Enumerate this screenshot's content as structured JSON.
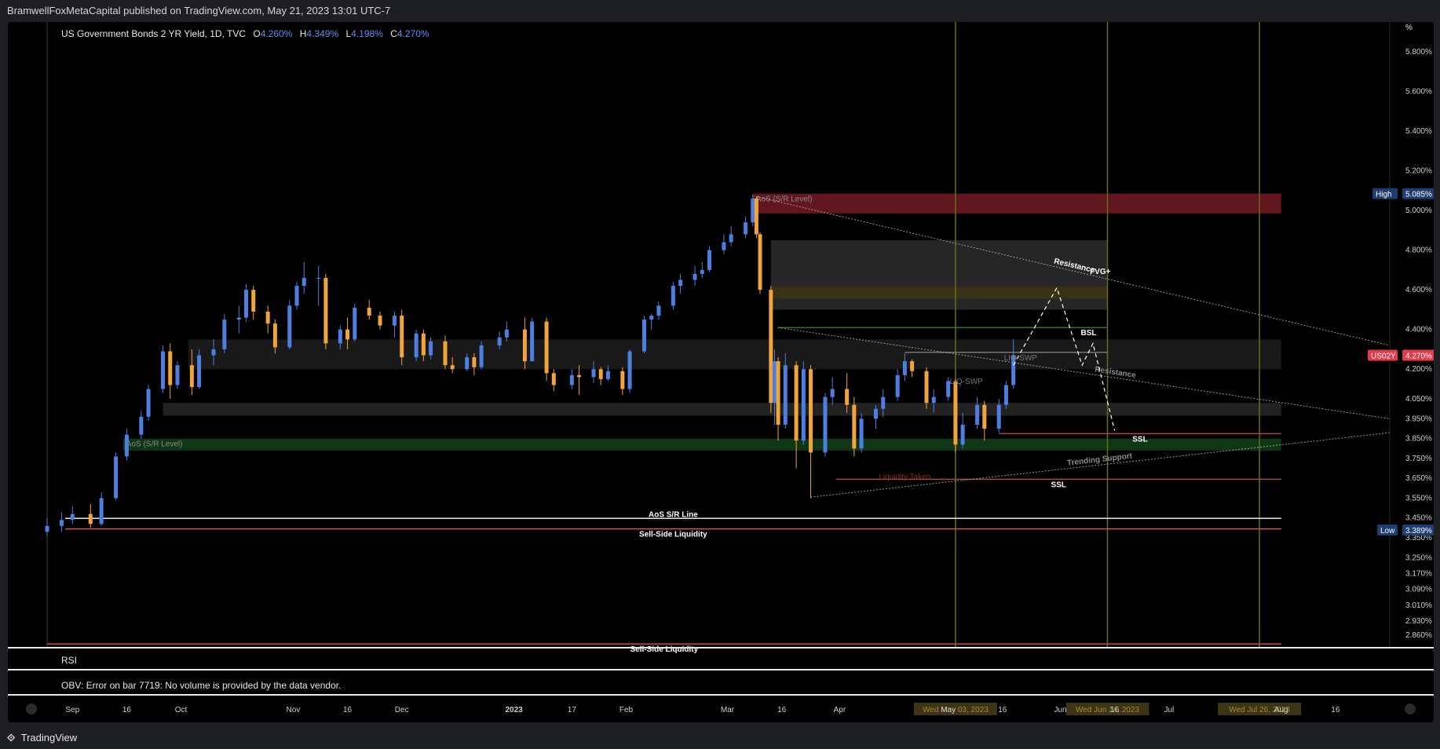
{
  "header": {
    "published": "BramwellFoxMetaCapital published on TradingView.com, May 21, 2023 13:01 UTC-7"
  },
  "legend": {
    "title": "US Government Bonds 2 YR Yield, 1D, TVC",
    "o_label": "O",
    "o_value": "4.260%",
    "h_label": "H",
    "h_value": "4.349%",
    "l_label": "L",
    "l_value": "4.198%",
    "c_label": "C",
    "c_value": "4.270%"
  },
  "panes": {
    "rsi_label": "RSI",
    "obv_label": "OBV: Error on bar 7719: No volume is provided by the data vendor."
  },
  "footer": {
    "brand": "TradingView"
  },
  "colors": {
    "up": "#4d7fe0",
    "down": "#f0a43a",
    "background": "#000000",
    "supply_zone": "#6b1a20",
    "fvg": "#3d3415",
    "demand_zone": "#123d17",
    "gray_zone": "#2a2a2a"
  },
  "chart_data": {
    "type": "candlestick",
    "title": "US Government Bonds 2 YR Yield, 1D, TVC",
    "symbol": "US02Y",
    "y_unit": "%",
    "ylim": [
      2.8,
      5.95
    ],
    "y_ticks": [
      "5.800%",
      "5.600%",
      "5.400%",
      "5.200%",
      "5.000%",
      "4.800%",
      "4.600%",
      "4.400%",
      "4.200%",
      "4.050%",
      "3.950%",
      "3.850%",
      "3.750%",
      "3.650%",
      "3.550%",
      "3.450%",
      "3.350%",
      "3.250%",
      "3.170%",
      "3.090%",
      "3.010%",
      "2.930%",
      "2.860%"
    ],
    "y_tick_values": [
      5.8,
      5.6,
      5.4,
      5.2,
      5.0,
      4.8,
      4.6,
      4.4,
      4.2,
      4.05,
      3.95,
      3.85,
      3.75,
      3.65,
      3.55,
      3.45,
      3.35,
      3.25,
      3.17,
      3.09,
      3.01,
      2.93,
      2.86
    ],
    "price_labels": [
      {
        "label": "High",
        "value": "5.085%",
        "num": 5.085,
        "color": "#1f3d73"
      },
      {
        "label": "US02Y",
        "value": "4.270%",
        "num": 4.27,
        "color": "#e23b4c"
      },
      {
        "label": "Low",
        "value": "3.389%",
        "num": 3.389,
        "color": "#1f3d73"
      }
    ],
    "x_ticks": [
      {
        "text": "Sep",
        "date": "2022-09-01"
      },
      {
        "text": "16",
        "date": "2022-09-16"
      },
      {
        "text": "Oct",
        "date": "2022-10-01"
      },
      {
        "text": "Nov",
        "date": "2022-11-01"
      },
      {
        "text": "16",
        "date": "2022-11-16"
      },
      {
        "text": "Dec",
        "date": "2022-12-01"
      },
      {
        "text": "2023",
        "date": "2023-01-01",
        "bold": true
      },
      {
        "text": "17",
        "date": "2023-01-17"
      },
      {
        "text": "Feb",
        "date": "2023-02-01"
      },
      {
        "text": "Mar",
        "date": "2023-03-01"
      },
      {
        "text": "16",
        "date": "2023-03-16"
      },
      {
        "text": "Apr",
        "date": "2023-04-01"
      },
      {
        "text": "May",
        "date": "2023-05-01"
      },
      {
        "text": "16",
        "date": "2023-05-16"
      },
      {
        "text": "Jun",
        "date": "2023-06-01"
      },
      {
        "text": "16",
        "date": "2023-06-16"
      },
      {
        "text": "Jul",
        "date": "2023-07-01"
      },
      {
        "text": "Aug",
        "date": "2023-08-01"
      },
      {
        "text": "16",
        "date": "2023-08-16"
      }
    ],
    "x_highlight_labels": [
      {
        "text": "Wed May 03, 2023",
        "date": "2023-05-03"
      },
      {
        "text": "Wed Jun 14, 2023",
        "date": "2023-06-14"
      },
      {
        "text": "Wed Jul 26, 2023",
        "date": "2023-07-26"
      }
    ],
    "x_range": [
      "2022-08-25",
      "2023-08-31"
    ],
    "ohlc": [
      [
        "2022-08-25",
        3.38,
        3.45,
        3.36,
        3.41
      ],
      [
        "2022-08-29",
        3.41,
        3.48,
        3.38,
        3.44
      ],
      [
        "2022-09-01",
        3.44,
        3.51,
        3.42,
        3.47
      ],
      [
        "2022-09-06",
        3.47,
        3.52,
        3.4,
        3.42
      ],
      [
        "2022-09-09",
        3.42,
        3.58,
        3.41,
        3.55
      ],
      [
        "2022-09-13",
        3.55,
        3.78,
        3.54,
        3.76
      ],
      [
        "2022-09-16",
        3.76,
        3.9,
        3.74,
        3.87
      ],
      [
        "2022-09-20",
        3.87,
        3.99,
        3.85,
        3.96
      ],
      [
        "2022-09-22",
        3.96,
        4.12,
        3.94,
        4.1
      ],
      [
        "2022-09-26",
        4.1,
        4.32,
        4.08,
        4.29
      ],
      [
        "2022-09-28",
        4.29,
        4.33,
        4.05,
        4.12
      ],
      [
        "2022-09-30",
        4.12,
        4.24,
        4.1,
        4.22
      ],
      [
        "2022-10-04",
        4.22,
        4.3,
        4.07,
        4.11
      ],
      [
        "2022-10-06",
        4.11,
        4.3,
        4.1,
        4.27
      ],
      [
        "2022-10-10",
        4.27,
        4.35,
        4.22,
        4.3
      ],
      [
        "2022-10-13",
        4.3,
        4.48,
        4.28,
        4.45
      ],
      [
        "2022-10-17",
        4.45,
        4.52,
        4.38,
        4.46
      ],
      [
        "2022-10-19",
        4.46,
        4.63,
        4.44,
        4.6
      ],
      [
        "2022-10-21",
        4.6,
        4.62,
        4.45,
        4.49
      ],
      [
        "2022-10-25",
        4.49,
        4.52,
        4.38,
        4.43
      ],
      [
        "2022-10-27",
        4.43,
        4.45,
        4.28,
        4.31
      ],
      [
        "2022-10-31",
        4.31,
        4.55,
        4.3,
        4.52
      ],
      [
        "2022-11-02",
        4.52,
        4.64,
        4.5,
        4.62
      ],
      [
        "2022-11-04",
        4.62,
        4.74,
        4.58,
        4.66
      ],
      [
        "2022-11-08",
        4.66,
        4.72,
        4.52,
        4.66
      ],
      [
        "2022-11-10",
        4.66,
        4.68,
        4.3,
        4.33
      ],
      [
        "2022-11-14",
        4.33,
        4.42,
        4.3,
        4.4
      ],
      [
        "2022-11-16",
        4.4,
        4.46,
        4.3,
        4.35
      ],
      [
        "2022-11-18",
        4.35,
        4.53,
        4.34,
        4.51
      ],
      [
        "2022-11-22",
        4.51,
        4.55,
        4.45,
        4.47
      ],
      [
        "2022-11-25",
        4.47,
        4.49,
        4.4,
        4.42
      ],
      [
        "2022-11-29",
        4.42,
        4.49,
        4.36,
        4.47
      ],
      [
        "2022-12-01",
        4.47,
        4.5,
        4.22,
        4.26
      ],
      [
        "2022-12-05",
        4.26,
        4.4,
        4.24,
        4.38
      ],
      [
        "2022-12-07",
        4.38,
        4.4,
        4.24,
        4.27
      ],
      [
        "2022-12-09",
        4.27,
        4.36,
        4.25,
        4.34
      ],
      [
        "2022-12-13",
        4.34,
        4.37,
        4.2,
        4.22
      ],
      [
        "2022-12-15",
        4.22,
        4.26,
        4.18,
        4.2
      ],
      [
        "2022-12-19",
        4.2,
        4.28,
        4.19,
        4.26
      ],
      [
        "2022-12-21",
        4.26,
        4.28,
        4.17,
        4.21
      ],
      [
        "2022-12-23",
        4.21,
        4.34,
        4.2,
        4.32
      ],
      [
        "2022-12-28",
        4.32,
        4.39,
        4.3,
        4.36
      ],
      [
        "2022-12-30",
        4.36,
        4.44,
        4.34,
        4.4
      ],
      [
        "2023-01-04",
        4.4,
        4.46,
        4.2,
        4.24
      ],
      [
        "2023-01-06",
        4.24,
        4.46,
        4.24,
        4.44
      ],
      [
        "2023-01-10",
        4.44,
        4.46,
        4.14,
        4.18
      ],
      [
        "2023-01-12",
        4.18,
        4.2,
        4.09,
        4.12
      ],
      [
        "2023-01-17",
        4.12,
        4.2,
        4.1,
        4.17
      ],
      [
        "2023-01-19",
        4.17,
        4.22,
        4.07,
        4.16
      ],
      [
        "2023-01-23",
        4.16,
        4.24,
        4.13,
        4.2
      ],
      [
        "2023-01-25",
        4.2,
        4.21,
        4.12,
        4.15
      ],
      [
        "2023-01-27",
        4.15,
        4.22,
        4.14,
        4.19
      ],
      [
        "2023-01-31",
        4.19,
        4.21,
        4.07,
        4.1
      ],
      [
        "2023-02-02",
        4.1,
        4.3,
        4.08,
        4.29
      ],
      [
        "2023-02-06",
        4.29,
        4.47,
        4.28,
        4.45
      ],
      [
        "2023-02-08",
        4.45,
        4.48,
        4.4,
        4.47
      ],
      [
        "2023-02-10",
        4.47,
        4.54,
        4.45,
        4.52
      ],
      [
        "2023-02-14",
        4.52,
        4.64,
        4.5,
        4.62
      ],
      [
        "2023-02-16",
        4.62,
        4.68,
        4.58,
        4.65
      ],
      [
        "2023-02-20",
        4.65,
        4.72,
        4.62,
        4.68
      ],
      [
        "2023-02-22",
        4.68,
        4.74,
        4.66,
        4.7
      ],
      [
        "2023-02-24",
        4.7,
        4.82,
        4.69,
        4.8
      ],
      [
        "2023-02-28",
        4.8,
        4.88,
        4.78,
        4.84
      ],
      [
        "2023-03-02",
        4.84,
        4.92,
        4.82,
        4.88
      ],
      [
        "2023-03-06",
        4.88,
        4.97,
        4.86,
        4.94
      ],
      [
        "2023-03-08",
        4.94,
        5.08,
        4.92,
        5.06
      ],
      [
        "2023-03-09",
        5.06,
        5.07,
        4.86,
        4.88
      ],
      [
        "2023-03-10",
        4.88,
        4.89,
        4.58,
        4.6
      ],
      [
        "2023-03-13",
        4.6,
        4.62,
        3.98,
        4.03
      ],
      [
        "2023-03-14",
        4.03,
        4.3,
        3.92,
        4.24
      ],
      [
        "2023-03-15",
        4.24,
        4.26,
        3.84,
        3.92
      ],
      [
        "2023-03-17",
        3.92,
        4.28,
        3.9,
        4.22
      ],
      [
        "2023-03-20",
        4.22,
        4.24,
        3.7,
        3.84
      ],
      [
        "2023-03-22",
        3.84,
        4.24,
        3.82,
        4.2
      ],
      [
        "2023-03-24",
        4.2,
        4.22,
        3.55,
        3.78
      ],
      [
        "2023-03-28",
        3.78,
        4.08,
        3.76,
        4.06
      ],
      [
        "2023-03-30",
        4.06,
        4.16,
        4.02,
        4.1
      ],
      [
        "2023-04-03",
        4.1,
        4.18,
        3.98,
        4.02
      ],
      [
        "2023-04-05",
        4.02,
        4.06,
        3.76,
        3.8
      ],
      [
        "2023-04-07",
        3.8,
        3.98,
        3.78,
        3.95
      ],
      [
        "2023-04-11",
        3.95,
        4.02,
        3.9,
        4.0
      ],
      [
        "2023-04-13",
        4.0,
        4.1,
        3.96,
        4.06
      ],
      [
        "2023-04-17",
        4.06,
        4.2,
        4.04,
        4.17
      ],
      [
        "2023-04-19",
        4.17,
        4.28,
        4.14,
        4.24
      ],
      [
        "2023-04-21",
        4.24,
        4.25,
        4.16,
        4.19
      ],
      [
        "2023-04-25",
        4.19,
        4.21,
        4.0,
        4.03
      ],
      [
        "2023-04-27",
        4.03,
        4.1,
        3.98,
        4.06
      ],
      [
        "2023-05-01",
        4.06,
        4.16,
        4.04,
        4.14
      ],
      [
        "2023-05-03",
        4.14,
        4.15,
        3.78,
        3.82
      ],
      [
        "2023-05-05",
        3.82,
        3.98,
        3.8,
        3.92
      ],
      [
        "2023-05-09",
        3.92,
        4.06,
        3.9,
        4.02
      ],
      [
        "2023-05-11",
        4.02,
        4.04,
        3.84,
        3.9
      ],
      [
        "2023-05-15",
        3.9,
        4.05,
        3.88,
        4.02
      ],
      [
        "2023-05-17",
        4.02,
        4.14,
        4.0,
        4.12
      ],
      [
        "2023-05-19",
        4.12,
        4.35,
        4.1,
        4.27
      ]
    ],
    "zones": [
      {
        "label": "AoS (S/R Level)",
        "from": "2023-03-08",
        "to": "2023-08-01",
        "y0": 4.985,
        "y1": 5.085,
        "color": "#6b1a20"
      },
      {
        "label": "",
        "from": "2023-03-13",
        "to": "2023-06-14",
        "y0": 4.5,
        "y1": 4.85,
        "color": "#2a2a2a"
      },
      {
        "label": "",
        "from": "2023-03-13",
        "to": "2023-06-14",
        "y0": 4.555,
        "y1": 4.615,
        "color": "#3d3415"
      },
      {
        "label": "",
        "from": "2022-10-03",
        "to": "2023-08-01",
        "y0": 4.2,
        "y1": 4.35,
        "color": "#1c1c1c"
      },
      {
        "label": "",
        "from": "2022-09-26",
        "to": "2023-08-01",
        "y0": 3.965,
        "y1": 4.03,
        "color": "#262626"
      },
      {
        "label": "AoS (S/R Level)",
        "from": "2022-09-15",
        "to": "2023-08-01",
        "y0": 3.79,
        "y1": 3.85,
        "color": "#123d17"
      }
    ],
    "hlines": [
      {
        "label": "AoS S/R Line",
        "from": "2022-08-30",
        "to": "2023-08-01",
        "y": 3.448,
        "color": "#e6e6e6"
      },
      {
        "label": "Sell-Side Liquidity",
        "from": "2022-08-30",
        "to": "2023-08-01",
        "y": 3.395,
        "color": "#e0504a"
      },
      {
        "label": "Sell-Side Liquidity",
        "from": "2022-08-25",
        "to": "2023-08-01",
        "y": 2.815,
        "color": "#e0504a"
      },
      {
        "label": "BSL",
        "from": "2023-03-15",
        "to": "2023-06-14",
        "y": 4.41,
        "color": "#3d7a2a"
      },
      {
        "label": "",
        "from": "2023-04-19",
        "to": "2023-06-14",
        "y": 4.285,
        "color": "#777777"
      },
      {
        "label": "SSL",
        "from": "2023-05-15",
        "to": "2023-08-01",
        "y": 3.875,
        "color": "#b34a4a"
      },
      {
        "label": "SSL",
        "from": "2023-03-31",
        "to": "2023-08-01",
        "y": 3.645,
        "color": "#b34a4a"
      }
    ],
    "vlines": [
      {
        "date": "2023-05-03",
        "color": "#6b6b1f"
      },
      {
        "date": "2023-06-14",
        "color": "#6b6b1f"
      },
      {
        "date": "2023-07-26",
        "color": "#6b6b1f"
      }
    ],
    "trendlines": [
      {
        "label": "Resistance",
        "from": [
          "2023-03-09",
          5.07
        ],
        "to": [
          "2023-08-31",
          4.32
        ],
        "color": "#bbbbbb"
      },
      {
        "label": "Resistance",
        "from": [
          "2023-03-15",
          4.41
        ],
        "to": [
          "2023-08-31",
          3.95
        ],
        "color": "#bbbbbb"
      },
      {
        "label": "Trending Support",
        "from": [
          "2023-03-24",
          3.555
        ],
        "to": [
          "2023-08-31",
          3.88
        ],
        "color": "#bbbbbb"
      }
    ],
    "text_annotations": [
      {
        "text": "LIQ-SWP",
        "date": "2023-05-21",
        "y": 4.245,
        "color": "#777777"
      },
      {
        "text": "LIQ-SWP",
        "date": "2023-05-06",
        "y": 4.125,
        "color": "#777777"
      },
      {
        "text": "Liquidity Taken",
        "date": "2023-04-19",
        "y": 3.645,
        "color": "#8a2a2a"
      },
      {
        "text": "FVG+",
        "date": "2023-06-12",
        "y": 4.68,
        "color": "#ffffff",
        "bold": true
      }
    ],
    "projection": [
      [
        "2023-05-19",
        4.22
      ],
      [
        "2023-05-31",
        4.61
      ],
      [
        "2023-06-07",
        4.22
      ],
      [
        "2023-06-10",
        4.33
      ],
      [
        "2023-06-16",
        3.89
      ]
    ]
  }
}
